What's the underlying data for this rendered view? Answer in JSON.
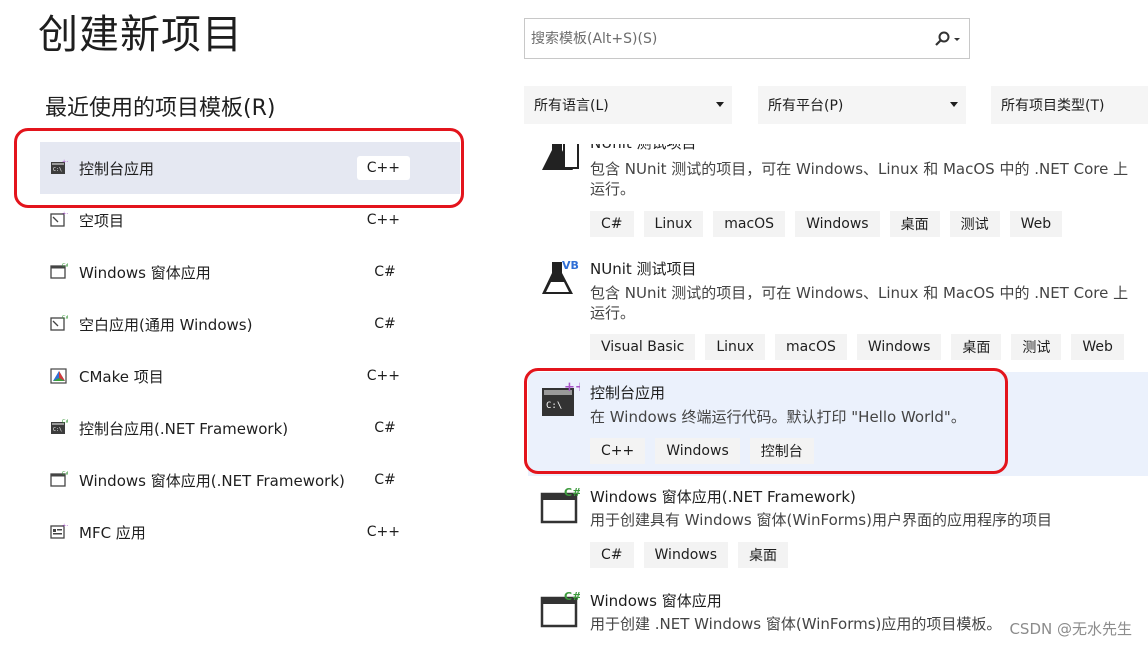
{
  "header": {
    "title": "创建新项目",
    "recent_heading": "最近使用的项目模板(R)"
  },
  "search": {
    "placeholder": "搜索模板(Alt+S)(S)"
  },
  "filters": {
    "language": "所有语言(L)",
    "platform": "所有平台(P)",
    "project_type": "所有项目类型(T)"
  },
  "recent": [
    {
      "name": "控制台应用",
      "lang": "C++",
      "icon": "console-app-icon"
    },
    {
      "name": "空项目",
      "lang": "C++",
      "icon": "empty-project-icon"
    },
    {
      "name": "Windows 窗体应用",
      "lang": "C#",
      "icon": "windows-form-icon"
    },
    {
      "name": "空白应用(通用 Windows)",
      "lang": "C#",
      "icon": "blank-uwp-icon"
    },
    {
      "name": "CMake 项目",
      "lang": "C++",
      "icon": "cmake-icon"
    },
    {
      "name": "控制台应用(.NET Framework)",
      "lang": "C#",
      "icon": "console-app-icon"
    },
    {
      "name": "Windows 窗体应用(.NET Framework)",
      "lang": "C#",
      "icon": "windows-form-icon"
    },
    {
      "name": "MFC 应用",
      "lang": "C++",
      "icon": "mfc-icon"
    }
  ],
  "templates": [
    {
      "title": "NUnit 测试项目",
      "desc": "包含 NUnit 测试的项目，可在 Windows、Linux 和 MacOS 中的 .NET Core 上运行。",
      "tags": [
        "C#",
        "Linux",
        "macOS",
        "Windows",
        "桌面",
        "测试",
        "Web"
      ],
      "icon": "nunit-csharp-icon"
    },
    {
      "title": "NUnit 测试项目",
      "desc": "包含 NUnit 测试的项目，可在 Windows、Linux 和 MacOS 中的 .NET Core 上运行。",
      "tags": [
        "Visual Basic",
        "Linux",
        "macOS",
        "Windows",
        "桌面",
        "测试",
        "Web"
      ],
      "icon": "nunit-vb-icon"
    },
    {
      "title": "控制台应用",
      "desc": "在 Windows 终端运行代码。默认打印 \"Hello World\"。",
      "tags": [
        "C++",
        "Windows",
        "控制台"
      ],
      "icon": "console-app-cpp-icon"
    },
    {
      "title": "Windows 窗体应用(.NET Framework)",
      "desc": "用于创建具有 Windows 窗体(WinForms)用户界面的应用程序的项目",
      "tags": [
        "C#",
        "Windows",
        "桌面"
      ],
      "icon": "windows-form-csharp-icon"
    },
    {
      "title": "Windows 窗体应用",
      "desc": "用于创建 .NET Windows 窗体(WinForms)应用的项目模板。",
      "tags": [],
      "icon": "windows-form-csharp-icon"
    }
  ],
  "watermark": "CSDN @无水先生",
  "colors": {
    "selected_bg": "#e5e8f2",
    "highlight_ring": "#e3141c",
    "template_selected_bg": "#ebf1fc"
  }
}
